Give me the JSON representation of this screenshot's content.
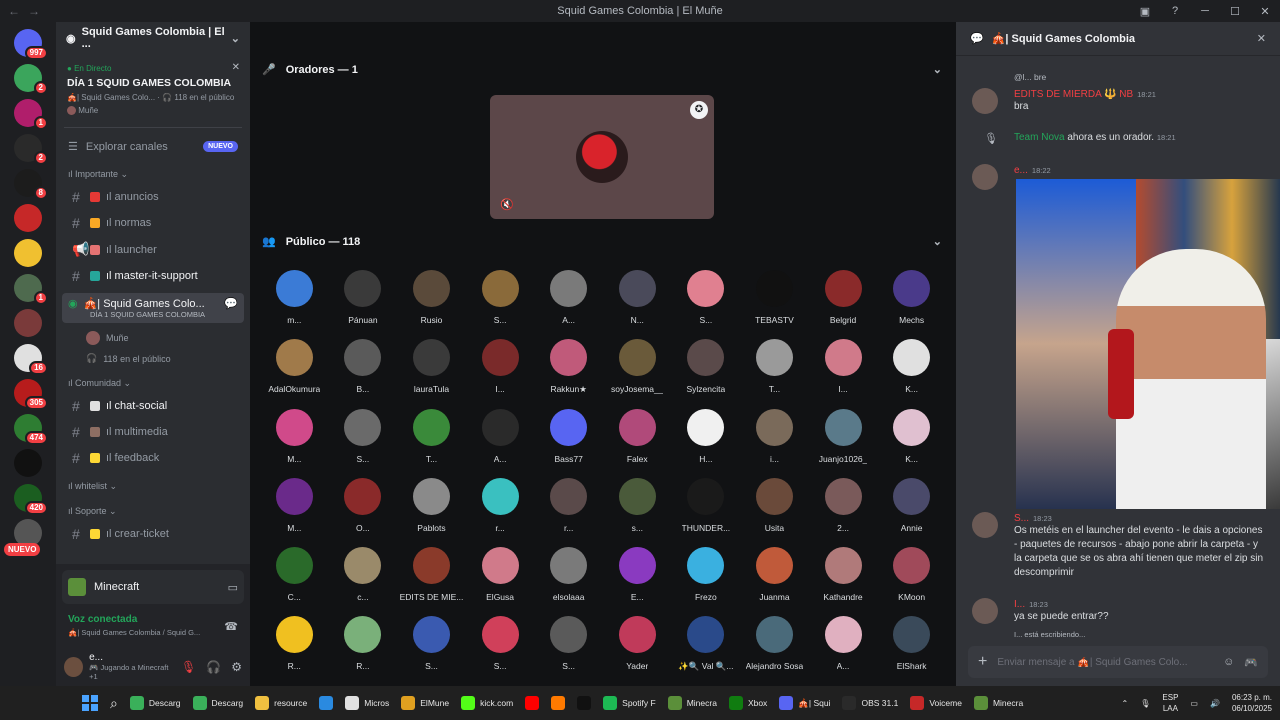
{
  "window": {
    "title": "Squid Games Colombia | El Muñe",
    "back": "←",
    "forward": "→"
  },
  "servers": {
    "items": [
      {
        "badge": "997",
        "color": "#5865f2"
      },
      {
        "badge": "2",
        "color": "#3ba55c"
      },
      {
        "badge": "1",
        "color": "#b01e6b"
      },
      {
        "badge": "2",
        "color": "#2a2a2a"
      },
      {
        "badge": "8",
        "color": "#1c1c1c"
      },
      {
        "badge": "",
        "color": "#c62828"
      },
      {
        "badge": "",
        "color": "#f0c030"
      },
      {
        "badge": "1",
        "color": "#4e6a4e"
      },
      {
        "badge": "",
        "color": "#7a3a3a"
      },
      {
        "badge": "16",
        "color": "#e0e0e0"
      },
      {
        "badge": "305",
        "color": "#b71c1c"
      },
      {
        "badge": "474",
        "color": "#2e7d32"
      },
      {
        "badge": "",
        "color": "#111111"
      },
      {
        "badge": "420",
        "color": "#1b5e20"
      },
      {
        "badge": "",
        "color": "#555555"
      }
    ],
    "new_label": "NUEVO"
  },
  "guild": {
    "name": "Squid Games Colombia | El ...",
    "event": {
      "live": "En Directo",
      "title": "DÍA 1 SQUID GAMES COLOMBIA",
      "meta": "🎪| Squid Games Colo...  ·  🎧 118 en el público",
      "host": "Muñe"
    },
    "explore": {
      "label": "Explorar canales",
      "pill": "NUEVO"
    },
    "categories": [
      {
        "name": "ıl Importante ⌄",
        "channels": [
          {
            "label": "ıl anuncios",
            "icon": "#",
            "emo": "#e53935"
          },
          {
            "label": "ıl normas",
            "icon": "#",
            "emo": "#f9a825"
          },
          {
            "label": "ıl launcher",
            "icon": "📢",
            "emo": "#e57373"
          },
          {
            "label": "ıl master-it-support",
            "icon": "#",
            "emo": "#26a69a"
          }
        ]
      },
      {
        "name": "ıl Comunidad ⌄",
        "channels": [
          {
            "label": "ıl chat-social",
            "icon": "#",
            "emo": "#e0e0e0"
          },
          {
            "label": "ıl multimedia",
            "icon": "#",
            "emo": "#8d6e63"
          },
          {
            "label": "ıl feedback",
            "icon": "#",
            "emo": "#fdd835"
          }
        ]
      },
      {
        "name": "ıl whitelist ⌄",
        "channels": []
      },
      {
        "name": "ıl Soporte ⌄",
        "channels": [
          {
            "label": "ıl crear-ticket",
            "icon": "#",
            "emo": "#fdd835"
          }
        ]
      }
    ],
    "active_stage": {
      "label": "🎪| Squid Games Colo...",
      "sub": "DÍA 1 SQUID GAMES COLOMBIA",
      "speaker": "Muñe",
      "audience": "118 en el público"
    }
  },
  "panel": {
    "activity": "Minecraft",
    "voice_status": "Voz conectada",
    "voice_detail": "🎪| Squid Games Colombia / Squid G...",
    "username": "e...",
    "user_status": "🎮 Jugando a Minecraft +1"
  },
  "stage": {
    "speakers_header": "Oradores — 1",
    "audience_header": "Público — 118",
    "audience": [
      {
        "name": "m...",
        "color": "#3b7bd6"
      },
      {
        "name": "Pánuan",
        "color": "#3a3a3a"
      },
      {
        "name": "Rusio",
        "color": "#5a4a3a"
      },
      {
        "name": "S...",
        "color": "#8a6a3a"
      },
      {
        "name": "A...",
        "color": "#7a7a7a"
      },
      {
        "name": "N...",
        "color": "#4a4a5a"
      },
      {
        "name": "S...",
        "color": "#e08090"
      },
      {
        "name": "TEBASTV",
        "color": "#111111"
      },
      {
        "name": "Belgrid",
        "color": "#8a2a2a"
      },
      {
        "name": "Mechs",
        "color": "#4a3a8a"
      },
      {
        "name": "AdalOkumura",
        "color": "#a07a4a"
      },
      {
        "name": "B...",
        "color": "#5a5a5a"
      },
      {
        "name": "lauraTula",
        "color": "#3a3a3a"
      },
      {
        "name": "I...",
        "color": "#7a2a2a"
      },
      {
        "name": "Rakkun★",
        "color": "#c05a7a"
      },
      {
        "name": "soyJosema__",
        "color": "#6a5a3a"
      },
      {
        "name": "Sylzencita",
        "color": "#5a4a4a"
      },
      {
        "name": "T...",
        "color": "#9a9a9a"
      },
      {
        "name": "I...",
        "color": "#d07a8a"
      },
      {
        "name": "K...",
        "color": "#e0e0e0"
      },
      {
        "name": "M...",
        "color": "#d04a8a"
      },
      {
        "name": "S...",
        "color": "#6a6a6a"
      },
      {
        "name": "T...",
        "color": "#3a8a3a"
      },
      {
        "name": "A...",
        "color": "#2a2a2a"
      },
      {
        "name": "Bass77",
        "color": "#5865f2"
      },
      {
        "name": "Falex",
        "color": "#b04a7a"
      },
      {
        "name": "H...",
        "color": "#f0f0f0"
      },
      {
        "name": "i...",
        "color": "#7a6a5a"
      },
      {
        "name": "Juanjo1026_",
        "color": "#5a7a8a"
      },
      {
        "name": "K...",
        "color": "#e0c0d0"
      },
      {
        "name": "M...",
        "color": "#6a2a8a"
      },
      {
        "name": "O...",
        "color": "#8a2a2a"
      },
      {
        "name": "Pablots",
        "color": "#8a8a8a"
      },
      {
        "name": "r...",
        "color": "#3ac0c0"
      },
      {
        "name": "r...",
        "color": "#5a4a4a"
      },
      {
        "name": "s...",
        "color": "#4a5a3a"
      },
      {
        "name": "THUNDER...",
        "color": "#1a1a1a"
      },
      {
        "name": "Usita",
        "color": "#6a4a3a"
      },
      {
        "name": "2...",
        "color": "#7a5a5a"
      },
      {
        "name": "Annie",
        "color": "#4a4a6a"
      },
      {
        "name": "C...",
        "color": "#2a6a2a"
      },
      {
        "name": "c...",
        "color": "#9a8a6a"
      },
      {
        "name": "EDITS DE MIE...",
        "color": "#8a3a2a"
      },
      {
        "name": "ElGusa",
        "color": "#d07a8a"
      },
      {
        "name": "elsolaaa",
        "color": "#7a7a7a"
      },
      {
        "name": "E...",
        "color": "#8a3ac0"
      },
      {
        "name": "Frezo",
        "color": "#3ab0e0"
      },
      {
        "name": "Juanma",
        "color": "#c05a3a"
      },
      {
        "name": "Kathandre",
        "color": "#b07a7a"
      },
      {
        "name": "KMoon",
        "color": "#a04a5a"
      },
      {
        "name": "R...",
        "color": "#f0c020"
      },
      {
        "name": "R...",
        "color": "#7ab07a"
      },
      {
        "name": "S...",
        "color": "#3a5ab0"
      },
      {
        "name": "S...",
        "color": "#d0405a"
      },
      {
        "name": "S...",
        "color": "#5a5a5a"
      },
      {
        "name": "Yader",
        "color": "#c03a5a"
      },
      {
        "name": "✨🔍 Val 🔍...",
        "color": "#2a4a8a"
      },
      {
        "name": "Alejandro Sosa",
        "color": "#4a6a7a"
      },
      {
        "name": "A...",
        "color": "#e0b0c0"
      },
      {
        "name": "ElShark",
        "color": "#3a4a5a"
      }
    ]
  },
  "chat": {
    "title": "🎪| Squid Games Colombia",
    "reply_preview": "@l...  bre",
    "messages": [
      {
        "author": "EDITS DE MIERDA 🔱 NB",
        "time": "18:21",
        "text": "bra"
      },
      {
        "author": "e...",
        "time": "18:22",
        "text": ""
      },
      {
        "author": "S...",
        "time": "18:23",
        "text": "Os metéis en el launcher del evento -  le dais a opciones - paquetes de recursos - abajo pone abrir la carpeta - y la carpeta que se os abra ahí tienen que meter el zip sin descomprimir"
      },
      {
        "author": "I...",
        "time": "18:23",
        "text": "ya se puede entrar??"
      }
    ],
    "system": {
      "name": "Team Nova",
      "text": " ahora es un orador.",
      "time": "18:21"
    },
    "typing": "I... está escribiendo...",
    "composer_placeholder": "Enviar mensaje a 🎪| Squid Games Colo..."
  },
  "taskbar": {
    "items": [
      {
        "label": "Descarg",
        "color": "#3ab05a"
      },
      {
        "label": "Descarg",
        "color": "#3ab05a"
      },
      {
        "label": "resource",
        "color": "#f0c040"
      },
      {
        "label": "",
        "color": "#2a8ae0"
      },
      {
        "label": "Micros",
        "color": "#e0e0e0"
      },
      {
        "label": "ElMune",
        "color": "#e0a020"
      },
      {
        "label": "kick.com",
        "color": "#53fc18"
      },
      {
        "label": "",
        "color": "#ff0000"
      },
      {
        "label": "",
        "color": "#ff7a00"
      },
      {
        "label": "",
        "color": "#111111"
      },
      {
        "label": "Spotify F",
        "color": "#1db954"
      },
      {
        "label": "Minecra",
        "color": "#5b8f3a"
      },
      {
        "label": "Xbox",
        "color": "#107c10"
      },
      {
        "label": "🎪| Squi",
        "color": "#5865f2"
      },
      {
        "label": "OBS 31.1",
        "color": "#2a2a2a"
      },
      {
        "label": "Voiceme",
        "color": "#c62828"
      },
      {
        "label": "Minecra",
        "color": "#5b8f3a"
      }
    ],
    "lang": "ESP",
    "lang2": "LAA",
    "time": "06:23 p. m.",
    "date": "06/10/2025"
  }
}
